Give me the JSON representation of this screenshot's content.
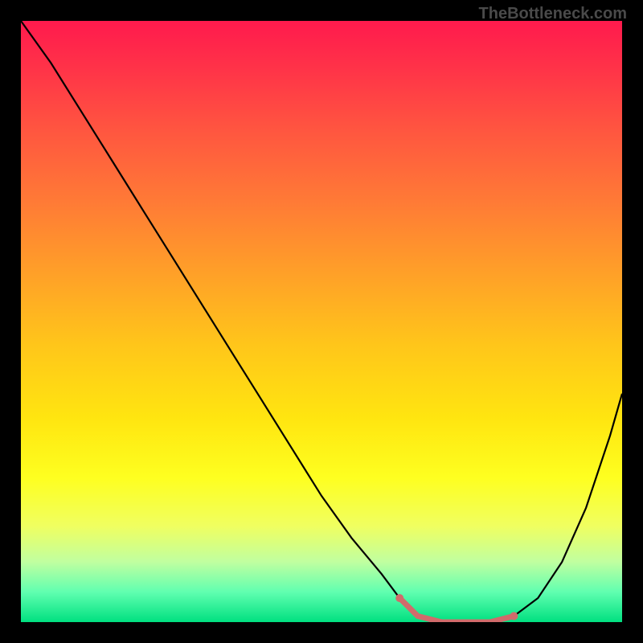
{
  "watermark": "TheBottleneck.com",
  "chart_data": {
    "type": "line",
    "title": "",
    "xlabel": "",
    "ylabel": "",
    "xlim": [
      0,
      100
    ],
    "ylim": [
      0,
      100
    ],
    "series": [
      {
        "name": "bottleneck-curve",
        "x": [
          0,
          5,
          10,
          15,
          20,
          25,
          30,
          35,
          40,
          45,
          50,
          55,
          60,
          63,
          66,
          70,
          74,
          78,
          82,
          86,
          90,
          94,
          98,
          100
        ],
        "values": [
          100,
          93,
          85,
          77,
          69,
          61,
          53,
          45,
          37,
          29,
          21,
          14,
          8,
          4,
          1,
          0,
          0,
          0,
          1,
          4,
          10,
          19,
          31,
          38
        ]
      },
      {
        "name": "highlight-segment",
        "x": [
          63,
          66,
          70,
          74,
          78,
          82
        ],
        "values": [
          4,
          1,
          0,
          0,
          0,
          1
        ],
        "color": "#d16b6b"
      }
    ],
    "annotations": [],
    "grid": false,
    "legend": false,
    "background": "gradient-vertical",
    "gradient_colors_top_to_bottom": [
      "#ff1a4d",
      "#ffa028",
      "#feff20",
      "#00e080"
    ]
  }
}
